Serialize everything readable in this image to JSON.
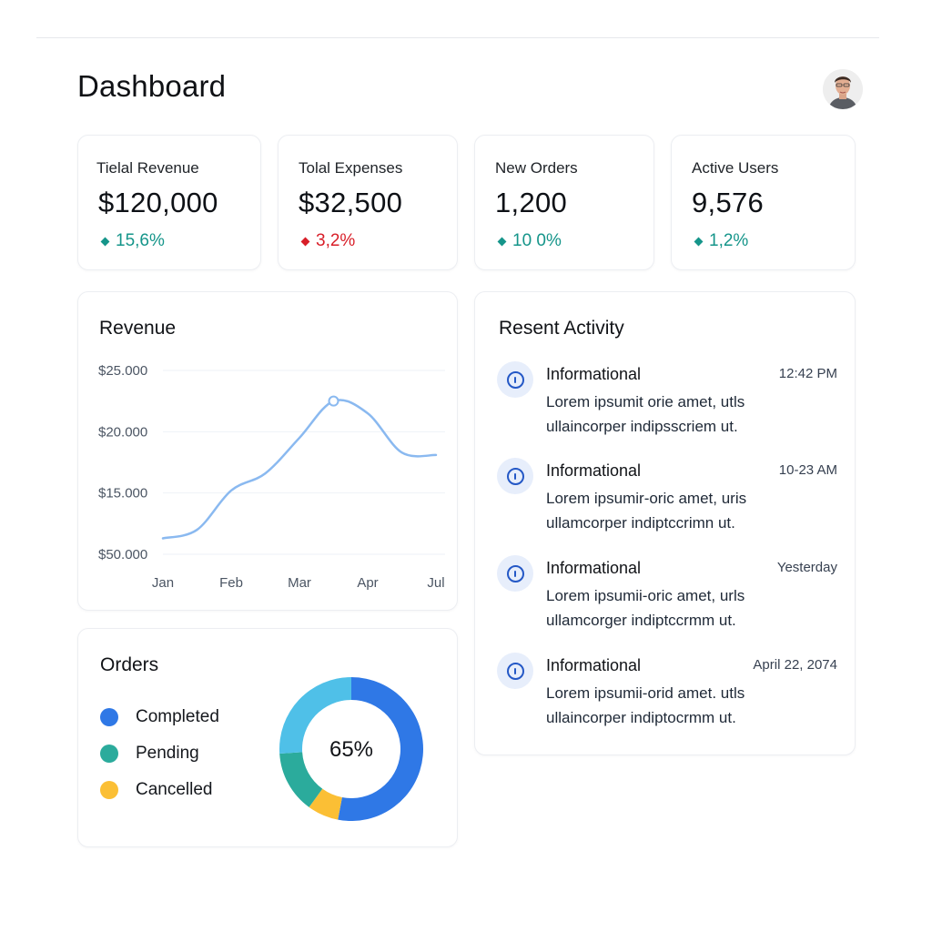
{
  "page": {
    "title": "Dashboard"
  },
  "user": {
    "avatar_icon": "user-avatar"
  },
  "stats": [
    {
      "label": "Tielal Revenue",
      "value": "$120,000",
      "change": "15,6%",
      "trend": "up",
      "color": "#15958a"
    },
    {
      "label": "Tolal Expenses",
      "value": "$32,500",
      "change": "3,2%",
      "trend": "down",
      "color": "#d81e28"
    },
    {
      "label": "New Orders",
      "value": "1,200",
      "change": "10 0%",
      "trend": "up",
      "color": "#15958a"
    },
    {
      "label": "Active Users",
      "value": "9,576",
      "change": "1,2%",
      "trend": "up",
      "color": "#15958a"
    }
  ],
  "revenue": {
    "title": "Revenue",
    "chart_data": {
      "type": "line",
      "title": "Revenue",
      "categories": [
        "Jan",
        "Feb",
        "Mar",
        "Apr",
        "Jul"
      ],
      "y_tick_labels": [
        "$25.000",
        "$20.000",
        "$15.000",
        "$50.000"
      ],
      "y_ticks": [
        25000,
        20000,
        15000,
        10000
      ],
      "ylim": [
        10000,
        25000
      ],
      "series": [
        {
          "x": [
            0,
            0.5,
            1,
            1.5,
            2,
            2.5,
            3,
            3.5,
            4
          ],
          "values": [
            11300,
            12000,
            15200,
            16600,
            19500,
            22500,
            21500,
            18300,
            18100
          ],
          "color": "#8ab9f0"
        }
      ],
      "highlight_index": 5,
      "grid": true
    }
  },
  "orders": {
    "title": "Orders",
    "center_label": "65%",
    "chart_data": {
      "type": "pie",
      "labels": [
        "Completed",
        "Pending",
        "Cancelled"
      ],
      "segments": [
        {
          "label": "Completed",
          "value": 53,
          "color": "#2f78e6"
        },
        {
          "label": "Cancelled",
          "value": 7,
          "color": "#fbbf35"
        },
        {
          "label": "Pending",
          "value": 14,
          "color": "#2bab9c"
        },
        {
          "label": "",
          "value": 26,
          "color": "#4fc0e8"
        }
      ]
    },
    "legend": [
      {
        "label": "Completed",
        "color": "#2f78e6"
      },
      {
        "label": "Pending",
        "color": "#2bab9c"
      },
      {
        "label": "Cancelled",
        "color": "#fbbf35"
      }
    ]
  },
  "activity": {
    "title": "Resent Activity",
    "items": [
      {
        "title": "Informational",
        "time": "12:42 PM",
        "line1": "Lorem ipsumit orie amet, utls",
        "line2": "ullaincorper indipsscriem ut."
      },
      {
        "title": "Informational",
        "time": "10-23 AM",
        "line1": "Lorem ipsumir-oric amet, uris",
        "line2": "ullamcorper indiptccrimn ut."
      },
      {
        "title": "Informational",
        "time": "Yesterday",
        "line1": "Lorem ipsumii-oric amet, urls",
        "line2": "ullamcorger indiptccrmm ut."
      },
      {
        "title": "Informational",
        "time": "April 22, 2074",
        "line1": "Lorem ipsumii-orid amet. utls",
        "line2": "ullaincorper indiptocrmm ut."
      }
    ]
  }
}
